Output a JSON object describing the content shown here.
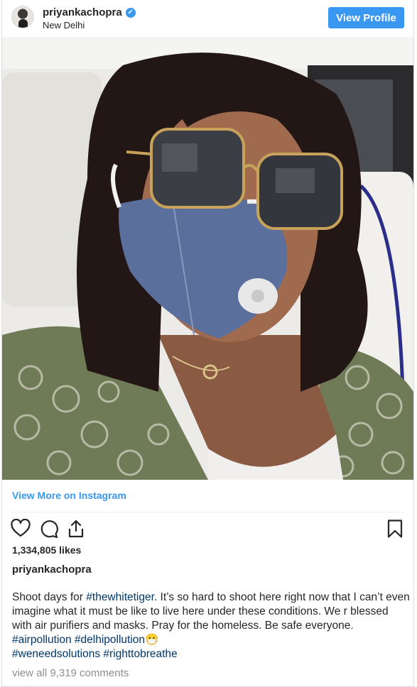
{
  "header": {
    "username": "priyankachopra",
    "verified_icon": "verified-badge-icon",
    "location": "New Delhi",
    "view_profile_label": "View Profile"
  },
  "post": {
    "view_more_label": "View More on Instagram",
    "likes": "1,334,805 likes",
    "caption_user": "priyankachopra",
    "caption": {
      "part1": "Shoot days for ",
      "tag1": "#thewhitetiger",
      "part2": ". It’s so hard to shoot here right now that I can’t even imagine what it must be like to live here under these conditions. We r blessed with air purifiers and masks. Pray for the homeless. Be safe everyone. ",
      "tag2": "#airpollution",
      "tag3": "#delhipollution",
      "emoji": "😷",
      "tag4": "#weneedsolutions",
      "tag5": "#righttobreathe"
    },
    "comments_label": "view all 9,319 comments"
  },
  "icons": {
    "like": "heart-icon",
    "comment": "comment-icon",
    "share": "share-icon",
    "save": "bookmark-icon"
  },
  "colors": {
    "accent": "#3897f0",
    "hashtag": "#00376b",
    "muted": "#8e8e8e"
  }
}
